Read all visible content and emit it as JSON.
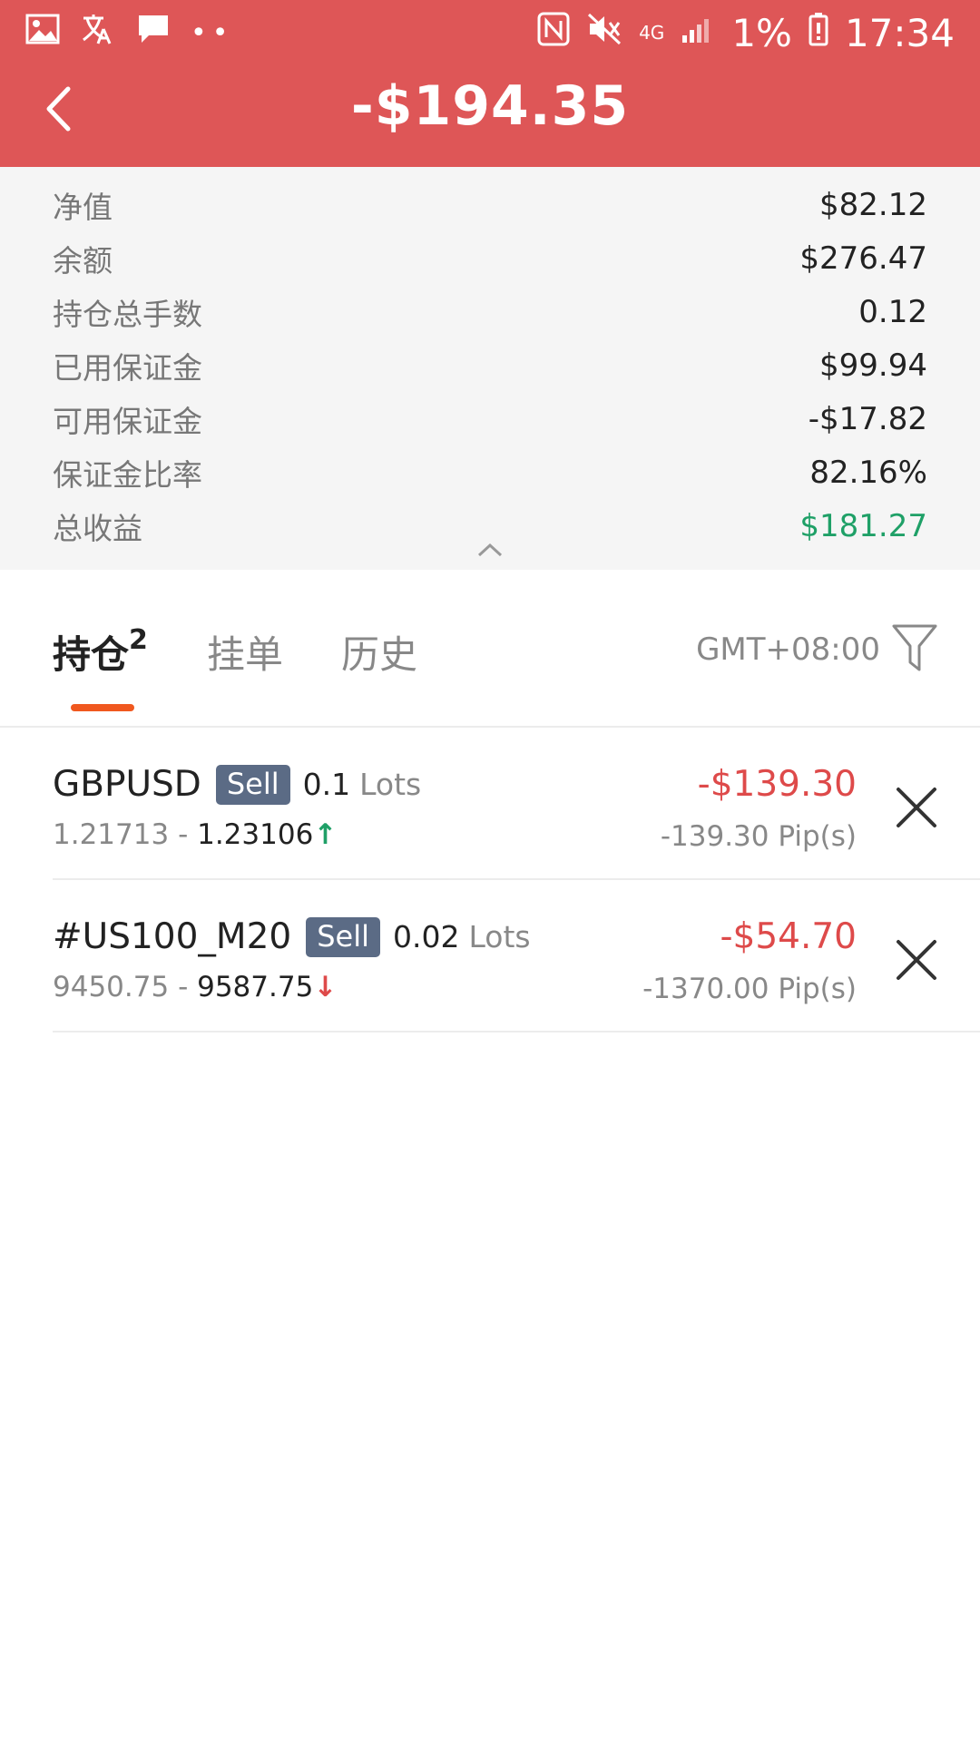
{
  "status_bar": {
    "percent": "1%",
    "time": "17:34",
    "network": "4G",
    "icons": [
      "gallery-icon",
      "translate-icon",
      "message-icon",
      "more-dots-icon",
      "nfc-icon",
      "mute-icon",
      "signal-icon",
      "battery-icon"
    ]
  },
  "header": {
    "title": "-$194.35",
    "background": "#de5657"
  },
  "summary": {
    "rows": [
      {
        "label": "净值",
        "value": "$82.12"
      },
      {
        "label": "余额",
        "value": "$276.47"
      },
      {
        "label": "持仓总手数",
        "value": "0.12"
      },
      {
        "label": "已用保证金",
        "value": "$99.94"
      },
      {
        "label": "可用保证金",
        "value": "-$17.82"
      },
      {
        "label": "保证金比率",
        "value": "82.16%"
      },
      {
        "label": "总收益",
        "value": "$181.27"
      }
    ]
  },
  "tabs": {
    "items": [
      {
        "label": "持仓",
        "count": "2"
      },
      {
        "label": "挂单"
      },
      {
        "label": "历史"
      }
    ],
    "timezone": "GMT+08:00",
    "accent": "#f0581f"
  },
  "positions": [
    {
      "symbol": "GBPUSD",
      "side": "Sell",
      "lots": "0.1",
      "lots_label": "Lots",
      "open_price": "1.21713",
      "separator": "-",
      "current_price": "1.23106",
      "direction_glyph": "↑",
      "profit": "-$139.30",
      "pips": "-139.30 Pip(s)"
    },
    {
      "symbol": "#US100_M20",
      "side": "Sell",
      "lots": "0.02",
      "lots_label": "Lots",
      "open_price": "9450.75",
      "separator": "-",
      "current_price": "9587.75",
      "direction_glyph": "↓",
      "profit": "-$54.70",
      "pips": "-1370.00 Pip(s)"
    }
  ],
  "colors": {
    "loss": "#de4a4a",
    "gain": "#1fa067",
    "badge": "#5b6b85"
  }
}
